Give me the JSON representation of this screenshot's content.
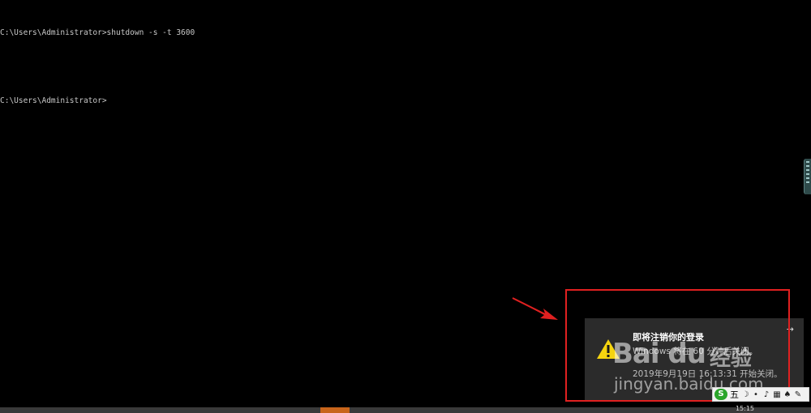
{
  "console": {
    "lines": [
      "C:\\Users\\Administrator>shutdown -s -t 3600",
      "",
      "C:\\Users\\Administrator>"
    ]
  },
  "notification": {
    "title": "即将注销你的登录",
    "body": "Windows 将在 60 分钟后关闭。",
    "time": "2019年9月19日 16:13:31 开始关闭。",
    "expand_label": "→",
    "icon": "warning-icon"
  },
  "watermark": {
    "logo": "Bai du",
    "subtitle": "经验",
    "url": "jingyan.baidu.com"
  },
  "ime_bar": {
    "logo": "S",
    "mode": "五",
    "icons": [
      "moon-icon",
      "dot-icon",
      "mic-icon",
      "keyboard-icon",
      "shirt-icon",
      "wrench-icon"
    ]
  },
  "taskbar": {
    "clock": "15:15"
  },
  "colors": {
    "highlight": "#e02020",
    "warning": "#f5d40f",
    "active_app": "#c8651b"
  }
}
